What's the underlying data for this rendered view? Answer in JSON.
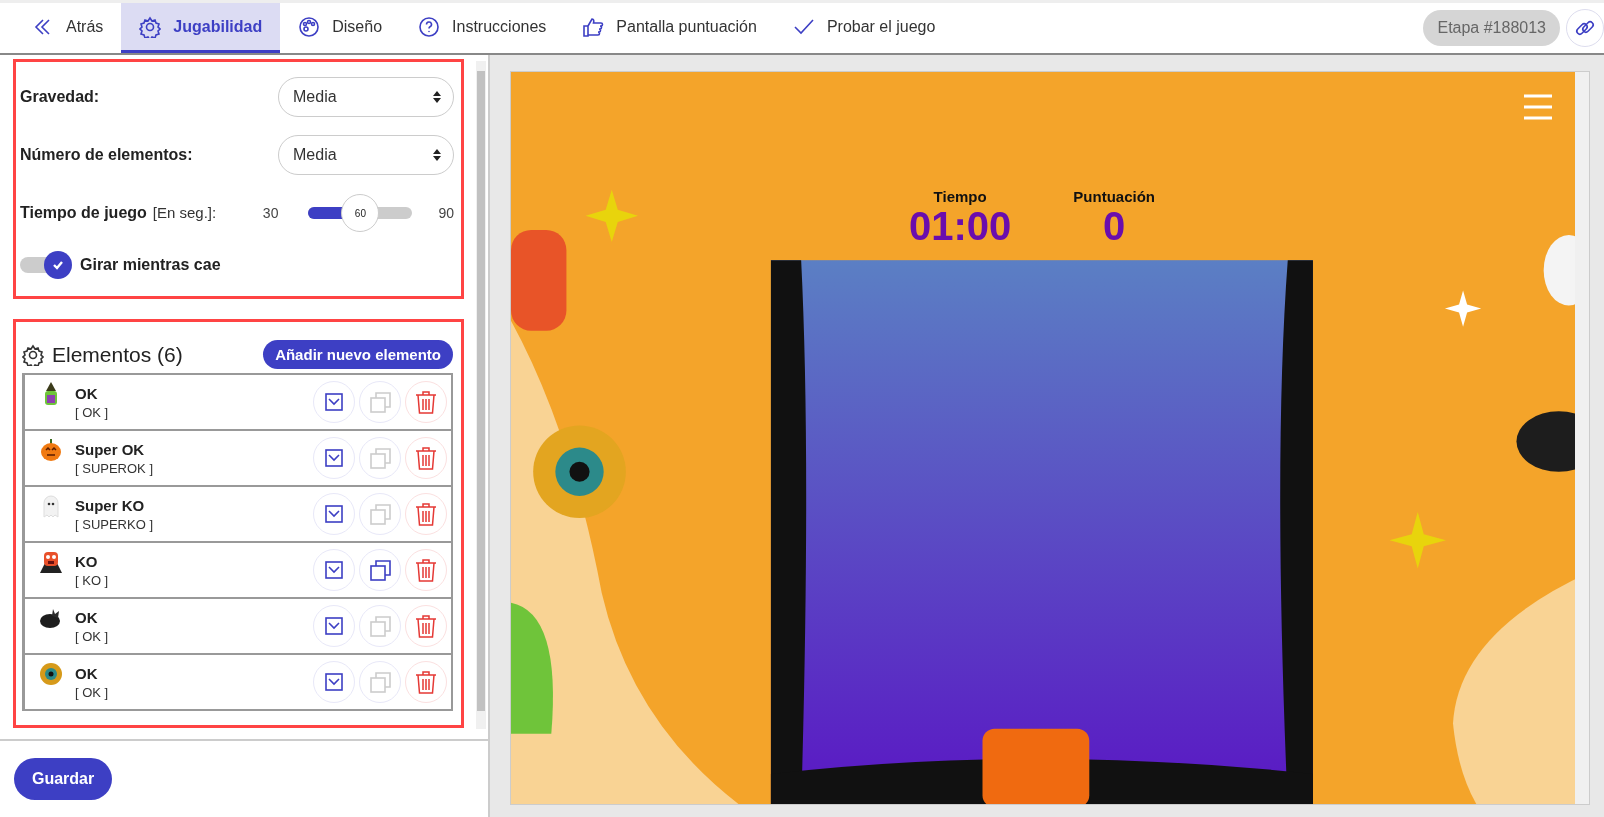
{
  "nav": {
    "back": "Atrás",
    "tabs": [
      {
        "label": "Jugabilidad",
        "selected": true
      },
      {
        "label": "Diseño",
        "selected": false
      },
      {
        "label": "Instrucciones",
        "selected": false
      },
      {
        "label": "Pantalla puntuación",
        "selected": false
      },
      {
        "label": "Probar el juego",
        "selected": false
      }
    ],
    "stage": "Etapa #188013"
  },
  "settings": {
    "gravity": {
      "label": "Gravedad:",
      "value": "Media"
    },
    "element_count": {
      "label": "Número de elementos:",
      "value": "Media"
    },
    "game_time": {
      "label": "Tiempo de juego",
      "hint": "[En seg.]:",
      "min": "30",
      "max": "90",
      "value": "60",
      "level": 0.5
    },
    "rotate": {
      "label": "Girar mientras cae",
      "checked": true
    }
  },
  "elements": {
    "title": "Elementos (6)",
    "add_button": "Añadir nuevo elemento",
    "items": [
      {
        "name": "OK",
        "type": "[ OK ]",
        "duplicate_disabled": true
      },
      {
        "name": "Super OK",
        "type": "[ SUPEROK ]",
        "duplicate_disabled": true
      },
      {
        "name": "Super KO",
        "type": "[ SUPERKO ]",
        "duplicate_disabled": true
      },
      {
        "name": "KO",
        "type": "[ KO ]",
        "duplicate_disabled": false
      },
      {
        "name": "OK",
        "type": "[ OK ]",
        "duplicate_disabled": true
      },
      {
        "name": "OK",
        "type": "[ OK ]",
        "duplicate_disabled": true
      }
    ]
  },
  "save_button": "Guardar",
  "game": {
    "time_label": "Tiempo",
    "time": "01:00",
    "score_label": "Puntuación",
    "score": "0"
  }
}
